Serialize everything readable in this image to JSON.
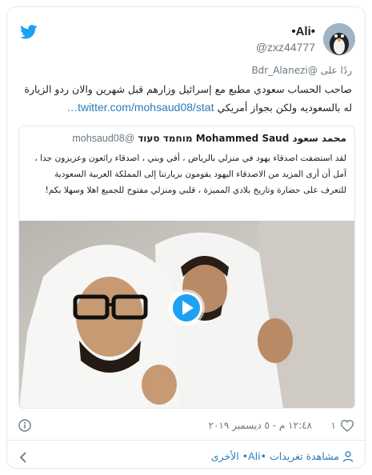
{
  "colors": {
    "brand": "#1da1f2",
    "link": "#2b7bb9",
    "muted": "#697882",
    "text": "#1c2022",
    "border": "#e1e8ed"
  },
  "header": {
    "display_name": "•Ali•",
    "handle": "@zxz44777",
    "logo_icon": "twitter-bird-icon"
  },
  "reply": {
    "prefix": "ردًا على",
    "to": "@Bdr_Alanezi"
  },
  "tweet": {
    "text": "صاحب الحساب سعودي مطبع مع إسرائيل وزارهم قبل شهرين والان ردو الزيارة له بالسعوديه ولكن بجواز أمريكي",
    "link": "twitter.com/mohsaud08/stat…"
  },
  "quote": {
    "name": "محمد سعود Mohammed Saud מוחמד סעוד",
    "handle": "@mohsaud08",
    "text": "لقد استضفت اصدقاء يهود  في منزلي بالرياض ، أفي وبني ، اصدقاء  رائعون وعزيزون جدا ، آمل أن أرى المزيد من الاصدقاء اليهود يقومون بزيارتنا إلى المملكة العربية السعودية للتعرف على حضارة وتاريخ بلادي المميزة ، قلبي ومنزلي مفتوح للجميع اهلا وسهلا بكم!",
    "media_icon": "play-icon"
  },
  "footer": {
    "like_count": "١",
    "timestamp": "١٢:٤٨ م - ٥ ديسمبر ٢٠١٩",
    "more_tweets": "مشاهدة تغريدات •Ali• الأخرى"
  }
}
